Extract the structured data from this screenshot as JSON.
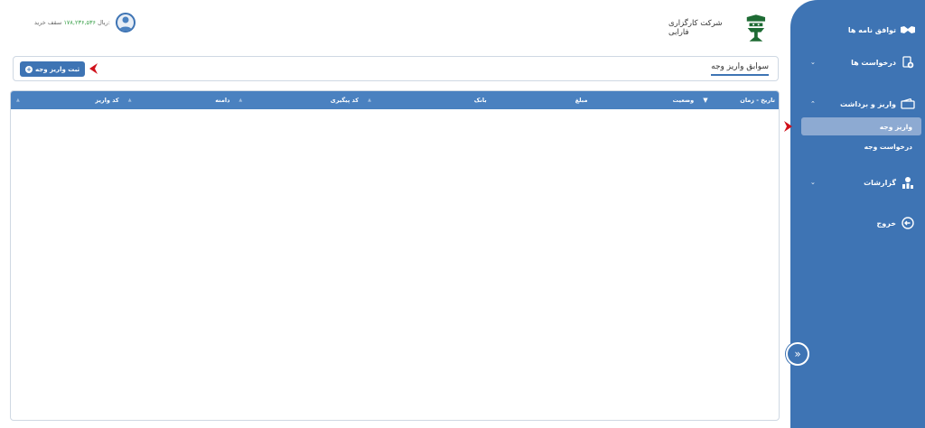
{
  "header": {
    "company_name": "شرکت کارگزاری فارابی",
    "credit_label": "سقف خرید:",
    "credit_amount": "۱۷۸,۲۳۶,۵۳۶",
    "credit_unit": "ریال"
  },
  "toolbar": {
    "page_title": "سوابق واریز وجه",
    "add_button": "ثبت واریز وجه"
  },
  "table": {
    "columns": [
      "تاریخ - زمان",
      "وضعیت",
      "مبلغ",
      "بانک",
      "کد پیگیری",
      "دامنه",
      "کد واریز"
    ],
    "rows": []
  },
  "sidebar": {
    "items": [
      {
        "label": "توافق نامه ها",
        "icon": "handshake-icon",
        "expandable": false
      },
      {
        "label": "درخواست ها",
        "icon": "request-add-icon",
        "expandable": true
      },
      {
        "label": "واریز و برداشت",
        "icon": "wallet-icon",
        "expandable": true,
        "expanded": true
      },
      {
        "label": "گزارشات",
        "icon": "report-icon",
        "expandable": true
      },
      {
        "label": "خروج",
        "icon": "logout-icon",
        "expandable": false
      }
    ],
    "subitems": [
      {
        "label": "واریز وجه",
        "active": true
      },
      {
        "label": "درخواست وجه",
        "active": false
      }
    ]
  },
  "colors": {
    "sidebar_bg": "#3e74b4",
    "table_header_bg": "#4a81c0",
    "active_subitem_bg": "#8daad2",
    "pointer_arrow": "#d0111b",
    "credit_amount": "#3aa14a"
  }
}
